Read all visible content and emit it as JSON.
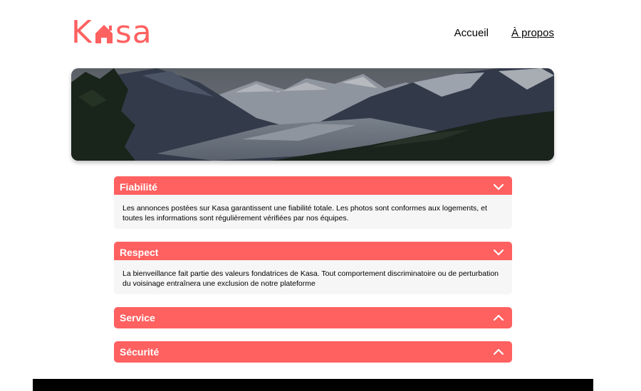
{
  "brand": {
    "logo_prefix": "K",
    "logo_suffix": "sa",
    "accent_color": "#ff6060"
  },
  "nav": {
    "items": [
      {
        "label": "Accueil",
        "active": false
      },
      {
        "label": "À propos",
        "active": true
      }
    ]
  },
  "banner": {
    "image": "mountain-landscape"
  },
  "collapses": [
    {
      "title": "Fiabilité",
      "expanded": true,
      "icon": "chevron-down-icon",
      "body": "Les annonces postées sur Kasa garantissent une fiabilité totale. Les photos sont conformes aux logements, et toutes les informations sont régulièrement vérifiées par nos équipes."
    },
    {
      "title": "Respect",
      "expanded": true,
      "icon": "chevron-down-icon",
      "body": "La bienveillance fait partie des valeurs fondatrices de Kasa. Tout comportement discriminatoire ou de perturbation du voisinage entraînera une exclusion de notre plateforme"
    },
    {
      "title": "Service",
      "expanded": false,
      "icon": "chevron-up-icon"
    },
    {
      "title": "Sécurité",
      "expanded": false,
      "icon": "chevron-up-icon"
    }
  ]
}
